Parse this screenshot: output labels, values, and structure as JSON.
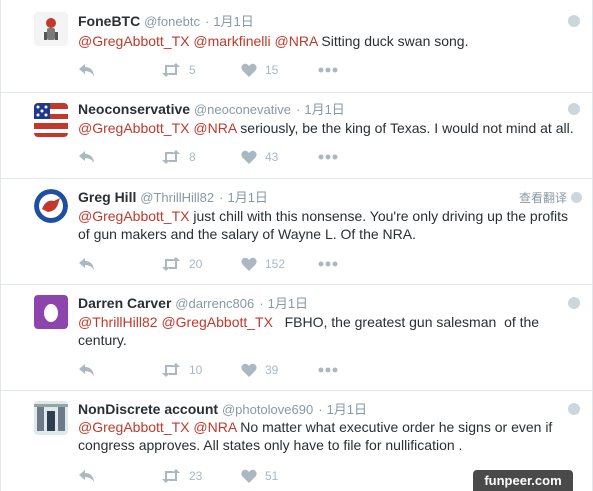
{
  "tweets": [
    {
      "name": "FoneBTC",
      "handle": "@fonebtc",
      "time": "1月1日",
      "text_parts": [
        {
          "t": "@GregAbbott_TX",
          "m": true
        },
        {
          "t": " ",
          "m": false
        },
        {
          "t": "@markfinelli",
          "m": true
        },
        {
          "t": " ",
          "m": false
        },
        {
          "t": "@NRA",
          "m": true
        },
        {
          "t": " Sitting duck swan song.",
          "m": false
        }
      ],
      "retweets": "5",
      "likes": "15",
      "avatar_icon": "character-avatar-icon",
      "translate_label": ""
    },
    {
      "name": "Neoconservative",
      "handle": "@neoconevative",
      "time": "1月1日",
      "text_parts": [
        {
          "t": "@GregAbbott_TX",
          "m": true
        },
        {
          "t": " ",
          "m": false
        },
        {
          "t": "@NRA",
          "m": true
        },
        {
          "t": " seriously, be the king of Texas. I would not mind at all.",
          "m": false
        }
      ],
      "retweets": "8",
      "likes": "43",
      "avatar_icon": "confederate-flag-avatar-icon",
      "translate_label": ""
    },
    {
      "name": "Greg Hill",
      "handle": "@ThrillHill82",
      "time": "1月1日",
      "text_parts": [
        {
          "t": "@GregAbbott_TX",
          "m": true
        },
        {
          "t": " just chill with this nonsense. You're only driving up the profits of gun makers and the salary of Wayne L. Of the NRA.",
          "m": false
        }
      ],
      "retweets": "20",
      "likes": "152",
      "avatar_icon": "mustang-logo-avatar-icon",
      "translate_label": "查看翻译"
    },
    {
      "name": "Darren Carver",
      "handle": "@darrenc806",
      "time": "1月1日",
      "text_parts": [
        {
          "t": "@ThrillHill82",
          "m": true
        },
        {
          "t": " ",
          "m": false
        },
        {
          "t": "@GregAbbott_TX",
          "m": true
        },
        {
          "t": "   FBHO, the greatest gun salesman  of the century.",
          "m": false
        }
      ],
      "retweets": "10",
      "likes": "39",
      "avatar_icon": "egg-avatar-icon",
      "translate_label": ""
    },
    {
      "name": "NonDiscrete account",
      "handle": "@photolove690",
      "time": "1月1日",
      "text_parts": [
        {
          "t": "@GregAbbott_TX",
          "m": true
        },
        {
          "t": " ",
          "m": false
        },
        {
          "t": "@NRA",
          "m": true
        },
        {
          "t": " No matter what executive order he signs or even if congress approves. All states only have to file for nullification .",
          "m": false
        }
      ],
      "retweets": "23",
      "likes": "51",
      "avatar_icon": "pillars-avatar-icon",
      "translate_label": ""
    }
  ],
  "watermark": "funpeer.com",
  "colors": {
    "mention": "#c0392b",
    "action_gray": "#aab8c2",
    "meta_gray": "#8899a6",
    "divider": "#e1e8ed"
  }
}
